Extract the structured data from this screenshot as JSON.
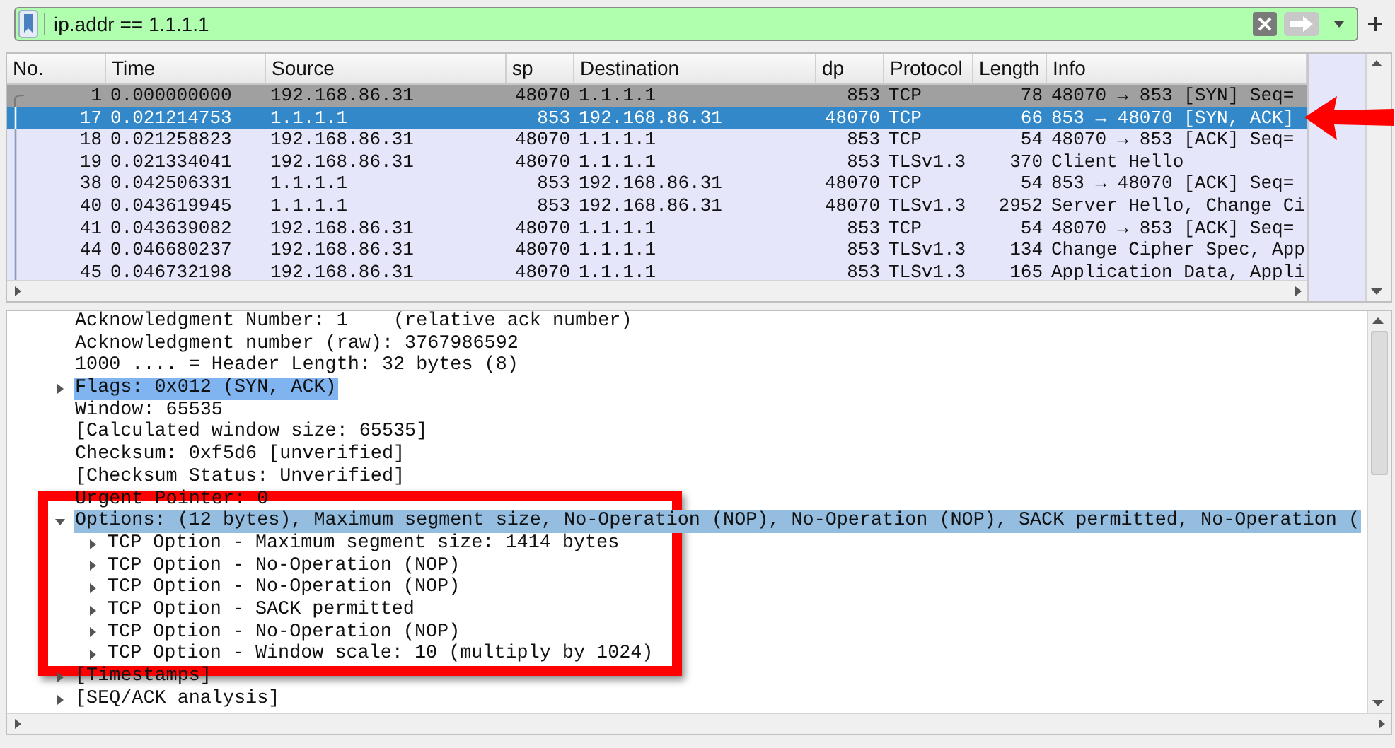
{
  "filter": {
    "value": "ip.addr == 1.1.1.1"
  },
  "packet_list": {
    "columns": [
      "No.",
      "Time",
      "Source",
      "sp",
      "Destination",
      "dp",
      "Protocol",
      "Length",
      "Info"
    ],
    "rows": [
      {
        "no": "1",
        "time": "0.000000000",
        "source": "192.168.86.31",
        "sp": "48070",
        "destination": "1.1.1.1",
        "dp": "853",
        "protocol": "TCP",
        "length": "78",
        "info": "48070 → 853 [SYN] Seq=",
        "color": "#a0a0a0",
        "selected": false
      },
      {
        "no": "17",
        "time": "0.021214753",
        "source": "1.1.1.1",
        "sp": "853",
        "destination": "192.168.86.31",
        "dp": "48070",
        "protocol": "TCP",
        "length": "66",
        "info": "853 → 48070 [SYN, ACK]",
        "selected": true
      },
      {
        "no": "18",
        "time": "0.021258823",
        "source": "192.168.86.31",
        "sp": "48070",
        "destination": "1.1.1.1",
        "dp": "853",
        "protocol": "TCP",
        "length": "54",
        "info": "48070 → 853 [ACK] Seq=",
        "color": "#e6e6fa",
        "selected": false
      },
      {
        "no": "19",
        "time": "0.021334041",
        "source": "192.168.86.31",
        "sp": "48070",
        "destination": "1.1.1.1",
        "dp": "853",
        "protocol": "TLSv1.3",
        "length": "370",
        "info": "Client Hello",
        "color": "#e6e6fa",
        "selected": false
      },
      {
        "no": "38",
        "time": "0.042506331",
        "source": "1.1.1.1",
        "sp": "853",
        "destination": "192.168.86.31",
        "dp": "48070",
        "protocol": "TCP",
        "length": "54",
        "info": "853 → 48070 [ACK] Seq=",
        "color": "#e6e6fa",
        "selected": false
      },
      {
        "no": "40",
        "time": "0.043619945",
        "source": "1.1.1.1",
        "sp": "853",
        "destination": "192.168.86.31",
        "dp": "48070",
        "protocol": "TLSv1.3",
        "length": "2952",
        "info": "Server Hello, Change Ci",
        "color": "#e6e6fa",
        "selected": false
      },
      {
        "no": "41",
        "time": "0.043639082",
        "source": "192.168.86.31",
        "sp": "48070",
        "destination": "1.1.1.1",
        "dp": "853",
        "protocol": "TCP",
        "length": "54",
        "info": "48070 → 853 [ACK] Seq=",
        "color": "#e6e6fa",
        "selected": false
      },
      {
        "no": "44",
        "time": "0.046680237",
        "source": "192.168.86.31",
        "sp": "48070",
        "destination": "1.1.1.1",
        "dp": "853",
        "protocol": "TLSv1.3",
        "length": "134",
        "info": "Change Cipher Spec, App",
        "color": "#e6e6fa",
        "selected": false
      },
      {
        "no": "45",
        "time": "0.046732198",
        "source": "192.168.86.31",
        "sp": "48070",
        "destination": "1.1.1.1",
        "dp": "853",
        "protocol": "TLSv1.3",
        "length": "165",
        "info": "Application Data, Appli",
        "color": "#e6e6fa",
        "selected": false
      }
    ]
  },
  "details": [
    {
      "text": "Acknowledgment Number: 1    (relative ack number)",
      "kind": "leaf"
    },
    {
      "text": "Acknowledgment number (raw): 3767986592",
      "kind": "leaf"
    },
    {
      "text": "1000 .... = Header Length: 32 bytes (8)",
      "kind": "leaf"
    },
    {
      "text": "Flags: 0x012 (SYN, ACK)",
      "kind": "node",
      "expanded": false,
      "selected": true
    },
    {
      "text": "Window: 65535",
      "kind": "leaf"
    },
    {
      "text": "[Calculated window size: 65535]",
      "kind": "leaf"
    },
    {
      "text": "Checksum: 0xf5d6 [unverified]",
      "kind": "leaf"
    },
    {
      "text": "[Checksum Status: Unverified]",
      "kind": "leaf"
    },
    {
      "text": "Urgent Pointer: 0",
      "kind": "leaf"
    },
    {
      "text": "Options: (12 bytes), Maximum segment size, No-Operation (NOP), No-Operation (NOP), SACK permitted, No-Operation (",
      "kind": "node",
      "expanded": true,
      "selected": false,
      "related": true,
      "children": [
        {
          "text": "TCP Option - Maximum segment size: 1414 bytes",
          "kind": "node",
          "expanded": false
        },
        {
          "text": "TCP Option - No-Operation (NOP)",
          "kind": "node",
          "expanded": false
        },
        {
          "text": "TCP Option - No-Operation (NOP)",
          "kind": "node",
          "expanded": false
        },
        {
          "text": "TCP Option - SACK permitted",
          "kind": "node",
          "expanded": false
        },
        {
          "text": "TCP Option - No-Operation (NOP)",
          "kind": "node",
          "expanded": false
        },
        {
          "text": "TCP Option - Window scale: 10 (multiply by 1024)",
          "kind": "node",
          "expanded": false
        }
      ]
    },
    {
      "text": "[Timestamps]",
      "kind": "node",
      "expanded": false
    },
    {
      "text": "[SEQ/ACK analysis]",
      "kind": "node",
      "expanded": false
    }
  ]
}
